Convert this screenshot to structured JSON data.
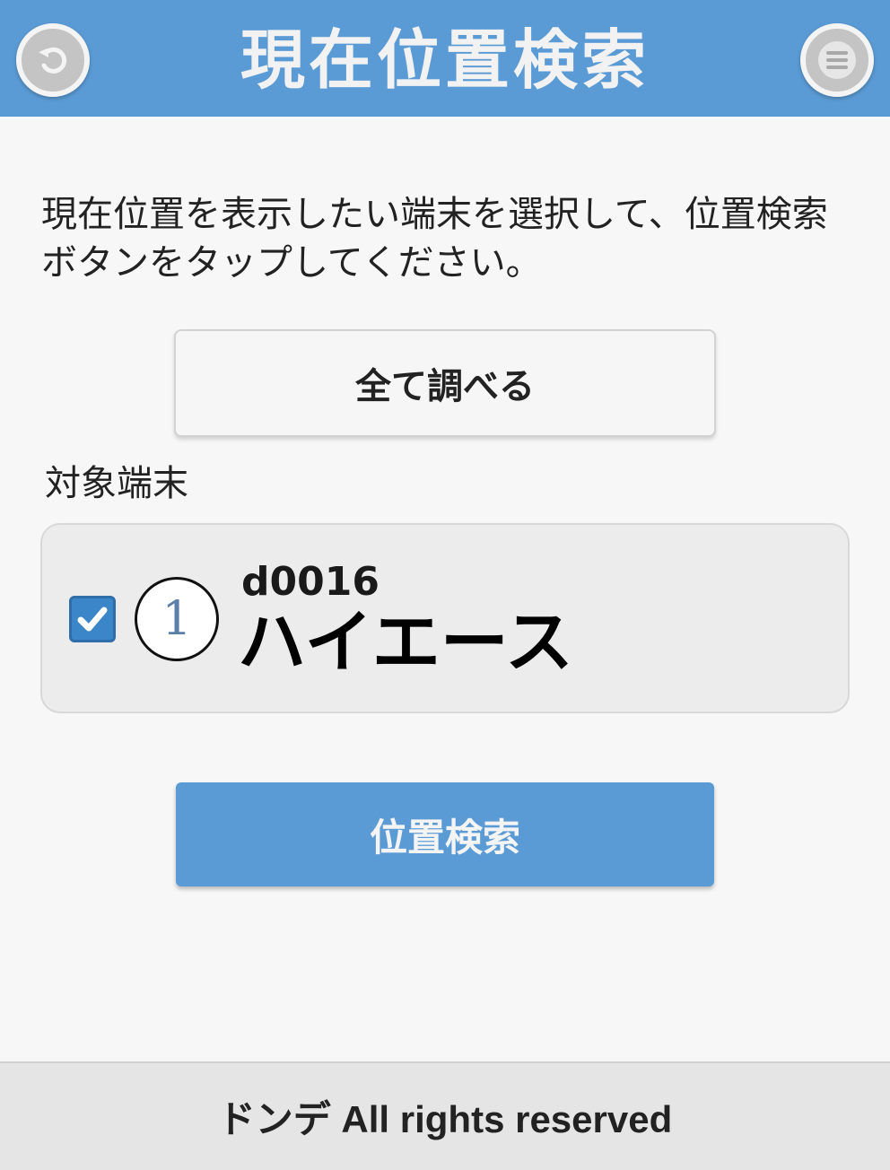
{
  "header": {
    "title": "現在位置検索",
    "back_icon": "back-arrow-icon",
    "menu_icon": "hamburger-menu-icon",
    "accent_color": "#5b9bd5"
  },
  "instruction": "現在位置を表示したい端末を選択して、位置検索ボタンをタップしてください。",
  "buttons": {
    "check_all": "全て調べる",
    "search": "位置検索"
  },
  "section_label": "対象端末",
  "devices": [
    {
      "checked": true,
      "marker": "1",
      "id": "d0016",
      "name": "ハイエース"
    }
  ],
  "footer": {
    "text": "ドンデ All rights reserved"
  }
}
